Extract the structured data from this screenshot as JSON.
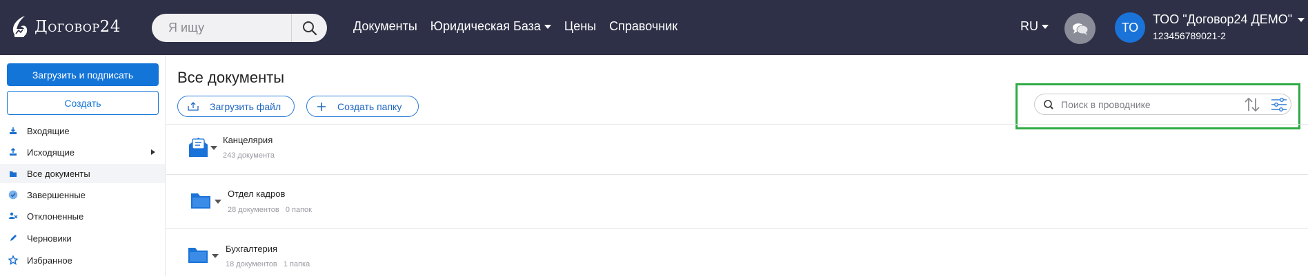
{
  "brand": {
    "name": "Договор24",
    "logo_icon": "droplet-logo-icon"
  },
  "header": {
    "search_placeholder": "Я ищу",
    "nav": [
      {
        "label": "Документы",
        "has_dropdown": false
      },
      {
        "label": "Юридическая База",
        "has_dropdown": true
      },
      {
        "label": "Цены",
        "has_dropdown": false
      },
      {
        "label": "Справочник",
        "has_dropdown": false
      }
    ],
    "language": "RU",
    "chat_icon": "chat-bubbles-icon",
    "user": {
      "initials": "ТО",
      "company": "ТОО \"Договор24 ДЕМО\"",
      "id": "123456789021-2"
    }
  },
  "sidebar": {
    "primary_button": "Загрузить и подписать",
    "secondary_button": "Создать",
    "items": [
      {
        "label": "Входящие",
        "icon": "inbox-download-icon",
        "active": false,
        "has_submenu": false
      },
      {
        "label": "Исходящие",
        "icon": "outbox-upload-icon",
        "active": false,
        "has_submenu": true
      },
      {
        "label": "Все документы",
        "icon": "folder-icon",
        "active": true,
        "has_submenu": false
      },
      {
        "label": "Завершенные",
        "icon": "check-circle-icon",
        "active": false,
        "has_submenu": false
      },
      {
        "label": "Отклоненные",
        "icon": "rejected-users-icon",
        "active": false,
        "has_submenu": false
      },
      {
        "label": "Черновики",
        "icon": "pencil-icon",
        "active": false,
        "has_submenu": false
      },
      {
        "label": "Избранное",
        "icon": "star-icon",
        "active": false,
        "has_submenu": false
      }
    ]
  },
  "main": {
    "title": "Все документы",
    "upload_file_button": "Загрузить файл",
    "create_folder_button": "Создать папку",
    "explorer_search_placeholder": "Поиск в проводнике",
    "folders": [
      {
        "name": "Канцелярия",
        "meta": [
          "243 документа"
        ],
        "icon": "mail-folder-icon"
      },
      {
        "name": "Отдел кадров",
        "meta": [
          "28 документов",
          "0 папок"
        ],
        "icon": "folder-icon"
      },
      {
        "name": "Бухгалтерия",
        "meta": [
          "18 документов",
          "1 папка"
        ],
        "icon": "folder-icon"
      }
    ]
  },
  "colors": {
    "navbar": "#2e3047",
    "accent": "#1475d9",
    "highlight": "#2eaa44"
  }
}
